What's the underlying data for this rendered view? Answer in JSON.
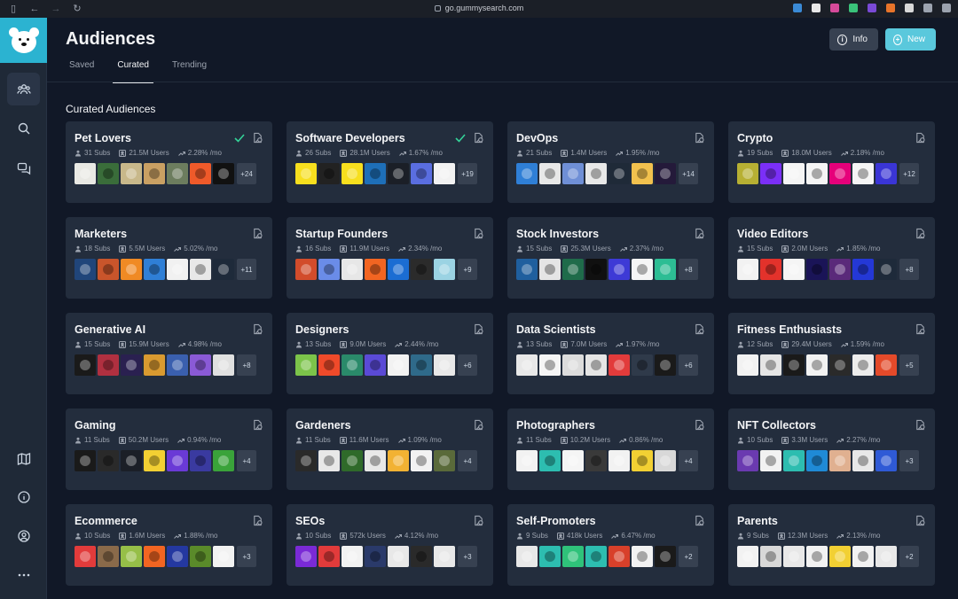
{
  "browser": {
    "url": "go.gummysearch.com"
  },
  "header": {
    "title": "Audiences"
  },
  "tabs": [
    {
      "label": "Saved"
    },
    {
      "label": "Curated"
    },
    {
      "label": "Trending"
    }
  ],
  "actions": {
    "info_label": "Info",
    "new_label": "New"
  },
  "section": {
    "title": "Curated Audiences"
  },
  "colors": {
    "accent": "#5ac8dc",
    "card_bg": "#232d3d",
    "page_bg": "#111827",
    "check": "#34d399"
  },
  "audiences": [
    {
      "name": "Pet Lovers",
      "subs": "31 Subs",
      "users": "21.5M Users",
      "growth": "2.28% /mo",
      "more": "+24",
      "saved": true,
      "thumbs": [
        "#e9e9e4",
        "#3a6d3a",
        "#c8b88a",
        "#c9a063",
        "#6c7d5e",
        "#ef5a2a",
        "#111"
      ]
    },
    {
      "name": "Software Developers",
      "subs": "26 Subs",
      "users": "28.1M Users",
      "growth": "1.67% /mo",
      "more": "+19",
      "saved": true,
      "thumbs": [
        "#f7df1e",
        "#222",
        "#f7df1e",
        "#1e6fb8",
        "#1b1f27",
        "#5a6ee0",
        "#f2f2f2"
      ]
    },
    {
      "name": "DevOps",
      "subs": "21 Subs",
      "users": "1.4M Users",
      "growth": "1.95% /mo",
      "more": "+14",
      "saved": false,
      "thumbs": [
        "#2f7fd6",
        "#e8e8e8",
        "#6f8fd6",
        "#e8e8e8",
        "#1f2a38",
        "#f2c14e",
        "#241a3a"
      ]
    },
    {
      "name": "Crypto",
      "subs": "19 Subs",
      "users": "18.0M Users",
      "growth": "2.18% /mo",
      "more": "+12",
      "saved": false,
      "thumbs": [
        "#b7b033",
        "#7b2ff7",
        "#f5f5f5",
        "#f5f5f5",
        "#e6007a",
        "#f5f5f5",
        "#3a35d6"
      ]
    },
    {
      "name": "Marketers",
      "subs": "18 Subs",
      "users": "5.5M Users",
      "growth": "5.02% /mo",
      "more": "+11",
      "saved": false,
      "thumbs": [
        "#20457a",
        "#c9552b",
        "#f08a24",
        "#2f7fd6",
        "#f1f1f1",
        "#e8e8e8",
        "#1e2a3a"
      ]
    },
    {
      "name": "Startup Founders",
      "subs": "16 Subs",
      "users": "11.9M Users",
      "growth": "2.34% /mo",
      "more": "+9",
      "saved": false,
      "thumbs": [
        "#d24c2b",
        "#6a8ce8",
        "#e7e7e7",
        "#f26522",
        "#1b6dd3",
        "#2b2b2b",
        "#9bd3e3"
      ]
    },
    {
      "name": "Stock Investors",
      "subs": "15 Subs",
      "users": "25.3M Users",
      "growth": "2.37% /mo",
      "more": "+8",
      "saved": false,
      "thumbs": [
        "#1f5f9e",
        "#e5e5e5",
        "#1f6b4a",
        "#101010",
        "#3d3ad6",
        "#f5f5f5",
        "#2dbd94"
      ]
    },
    {
      "name": "Video Editors",
      "subs": "15 Subs",
      "users": "2.0M Users",
      "growth": "1.85% /mo",
      "more": "+8",
      "saved": false,
      "thumbs": [
        "#f2f2f2",
        "#e3322b",
        "#f5f5f5",
        "#1a1457",
        "#5a2a7a",
        "#2438d6",
        "#1e2a3a"
      ]
    },
    {
      "name": "Generative AI",
      "subs": "15 Subs",
      "users": "15.9M Users",
      "growth": "4.98% /mo",
      "more": "+8",
      "saved": false,
      "thumbs": [
        "#1a1a1a",
        "#b03040",
        "#2a2050",
        "#d99a30",
        "#3a5fae",
        "#8a5ad6",
        "#e0e0e0"
      ]
    },
    {
      "name": "Designers",
      "subs": "13 Subs",
      "users": "9.0M Users",
      "growth": "2.44% /mo",
      "more": "+6",
      "saved": false,
      "thumbs": [
        "#7cc44a",
        "#ef4a2a",
        "#2a8a6a",
        "#5a4ad6",
        "#f2f2f2",
        "#2f6a8a",
        "#e8e8e8"
      ]
    },
    {
      "name": "Data Scientists",
      "subs": "13 Subs",
      "users": "7.0M Users",
      "growth": "1.97% /mo",
      "more": "+6",
      "saved": false,
      "thumbs": [
        "#e8e8e8",
        "#f5f5f5",
        "#dcdcdc",
        "#e5e5e5",
        "#e23b3b",
        "#2f3a4a",
        "#1a1a1a"
      ]
    },
    {
      "name": "Fitness Enthusiasts",
      "subs": "12 Subs",
      "users": "29.4M Users",
      "growth": "1.59% /mo",
      "more": "+5",
      "saved": false,
      "thumbs": [
        "#f2f2f2",
        "#e5e5e5",
        "#1a1a1a",
        "#f2f2f2",
        "#2a2a2a",
        "#ececec",
        "#e44a2a"
      ]
    },
    {
      "name": "Gaming",
      "subs": "11 Subs",
      "users": "50.2M Users",
      "growth": "0.94% /mo",
      "more": "+4",
      "saved": false,
      "thumbs": [
        "#1a1a1a",
        "#2a2a2a",
        "#1b1f27",
        "#f2d033",
        "#6a3ad6",
        "#3a3aa0",
        "#3aa33a"
      ]
    },
    {
      "name": "Gardeners",
      "subs": "11 Subs",
      "users": "11.6M Users",
      "growth": "1.09% /mo",
      "more": "+4",
      "saved": false,
      "thumbs": [
        "#2a2a2a",
        "#e8e8e8",
        "#2f6a2a",
        "#e8e8e8",
        "#f2b233",
        "#f2f2f2",
        "#5a6a3a"
      ]
    },
    {
      "name": "Photographers",
      "subs": "11 Subs",
      "users": "10.2M Users",
      "growth": "0.86% /mo",
      "more": "+4",
      "saved": false,
      "thumbs": [
        "#f2f2f2",
        "#2dbdb0",
        "#f5f5f5",
        "#3a3a3a",
        "#f2f2f2",
        "#f2d033",
        "#d8d8d8"
      ]
    },
    {
      "name": "NFT Collectors",
      "subs": "10 Subs",
      "users": "3.3M Users",
      "growth": "2.27% /mo",
      "more": "+3",
      "saved": false,
      "thumbs": [
        "#6a3ab0",
        "#f2f2f2",
        "#2dbdb0",
        "#1f8ad6",
        "#e0b090",
        "#e8e8e8",
        "#2f5ad6"
      ]
    },
    {
      "name": "Ecommerce",
      "subs": "10 Subs",
      "users": "1.6M Users",
      "growth": "1.88% /mo",
      "more": "+3",
      "saved": false,
      "thumbs": [
        "#e23b3b",
        "#8a6a4a",
        "#96bf48",
        "#f26522",
        "#2438a0",
        "#5a8a2a",
        "#f2f2f2"
      ]
    },
    {
      "name": "SEOs",
      "subs": "10 Subs",
      "users": "572k Users",
      "growth": "4.12% /mo",
      "more": "+3",
      "saved": false,
      "thumbs": [
        "#7a2ad6",
        "#e23b3b",
        "#f2f2f2",
        "#2a3a6a",
        "#e8e8e8",
        "#2a2a2a",
        "#e8e8e8"
      ]
    },
    {
      "name": "Self-Promoters",
      "subs": "9 Subs",
      "users": "418k Users",
      "growth": "6.47% /mo",
      "more": "+2",
      "saved": false,
      "thumbs": [
        "#e8e8e8",
        "#2dbdb0",
        "#2fc27a",
        "#2dbdb0",
        "#d8402a",
        "#f2f2f2",
        "#1a1a1a"
      ]
    },
    {
      "name": "Parents",
      "subs": "9 Subs",
      "users": "12.3M Users",
      "growth": "2.13% /mo",
      "more": "+2",
      "saved": false,
      "thumbs": [
        "#f2f2f2",
        "#d8d8d8",
        "#e8e8e8",
        "#f2f2f2",
        "#f2d033",
        "#f2f2f2",
        "#e8e8e8"
      ]
    }
  ]
}
